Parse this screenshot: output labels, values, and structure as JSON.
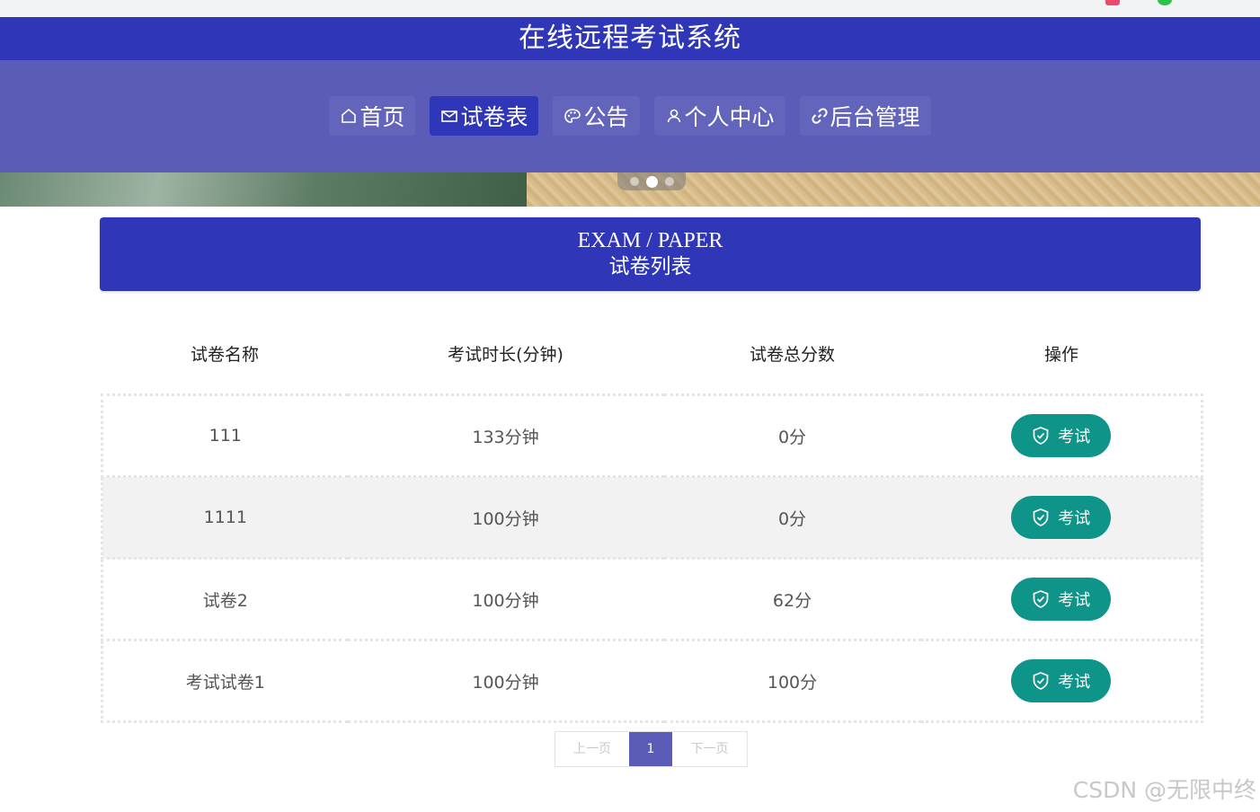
{
  "app": {
    "title": "在线远程考试系统"
  },
  "nav": [
    {
      "label": "首页",
      "icon": "home-icon"
    },
    {
      "label": "试卷表",
      "icon": "mail-icon",
      "active": true
    },
    {
      "label": "公告",
      "icon": "palette-icon"
    },
    {
      "label": "个人中心",
      "icon": "user-icon"
    },
    {
      "label": "后台管理",
      "icon": "link-icon"
    }
  ],
  "carousel": {
    "slide_count": 3,
    "active_index": 1
  },
  "section": {
    "title_en": "EXAM / PAPER",
    "title_zh": "试卷列表"
  },
  "table": {
    "headers": [
      "试卷名称",
      "考试时长(分钟)",
      "试卷总分数",
      "操作"
    ],
    "rows": [
      {
        "name": "111",
        "duration": "133分钟",
        "score": "0分",
        "action": "考试"
      },
      {
        "name": "1111",
        "duration": "100分钟",
        "score": "0分",
        "action": "考试"
      },
      {
        "name": "试卷2",
        "duration": "100分钟",
        "score": "62分",
        "action": "考试"
      },
      {
        "name": "考试试卷1",
        "duration": "100分钟",
        "score": "100分",
        "action": "考试"
      }
    ]
  },
  "pagination": {
    "prev": "上一页",
    "current": "1",
    "next": "下一页"
  },
  "watermark": "CSDN @无限中终",
  "colors": {
    "primary": "#2f36b7",
    "nav_band": "#5a5cb8",
    "button": "#0e9488"
  }
}
